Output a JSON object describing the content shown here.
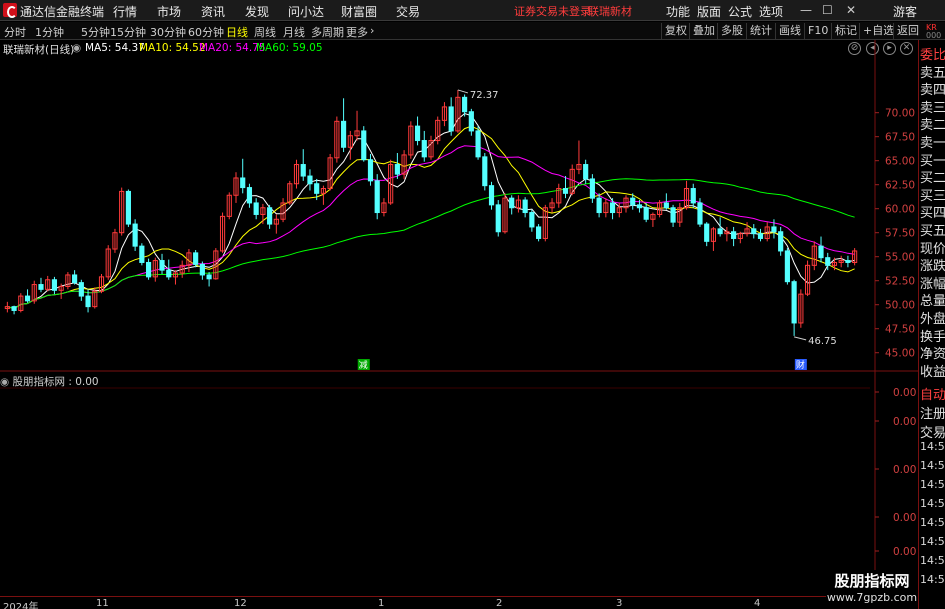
{
  "app": {
    "title": "通达信金融终端"
  },
  "menu": {
    "items": [
      "行情",
      "市场",
      "资讯",
      "发现",
      "问小达",
      "财富圈",
      "交易"
    ],
    "status": "证券交易未登录",
    "stock_link": "联瑞新材",
    "right_items": [
      "功能",
      "版面",
      "公式",
      "选项"
    ],
    "user": "游客"
  },
  "toolbar": {
    "timeframes": [
      "分时",
      "1分钟",
      "5分钟",
      "15分钟",
      "30分钟",
      "60分钟",
      "日线",
      "周线",
      "月线",
      "多周期",
      "更多"
    ],
    "active": "日线",
    "right_buttons": [
      "复权",
      "叠加",
      "多股",
      "统计",
      "画线",
      "F10",
      "标记",
      "+自选",
      "返回"
    ]
  },
  "legend": {
    "stock": "联瑞新材(日线)",
    "ma5_label": "MA5: 54.37",
    "ma10_label": "MA10: 54.52",
    "ma20_label": "MA20: 54.75",
    "ma60_label": "MA60: 59.05",
    "colors": {
      "ma5": "#ffffff",
      "ma10": "#ffff00",
      "ma20": "#ff00ff",
      "ma60": "#00ff00"
    }
  },
  "sub_indicator": {
    "label": "股朋指标网 : 0.00"
  },
  "right_panel": {
    "badge_top": "KR",
    "badge_bottom": "000",
    "labels": [
      "委比",
      "卖五",
      "卖四",
      "卖三",
      "卖二",
      "卖一",
      "买一",
      "买二",
      "买三",
      "买四",
      "买五",
      "现价",
      "涨跌",
      "涨幅",
      "总量",
      "外盘",
      "换手",
      "净资",
      "收益"
    ],
    "sub_labels": [
      "自动",
      "注册",
      "交易"
    ],
    "times": [
      "14:5",
      "14:55",
      "14:56",
      "14:56",
      "14:56",
      "14:56",
      "14:56",
      "14:56"
    ]
  },
  "watermark": {
    "title": "股朋指标网",
    "url": "www.7gpzb.com"
  },
  "bottom_axis": {
    "dates": [
      "2024年",
      "11",
      "12",
      "1",
      "2",
      "3",
      "4"
    ]
  },
  "chart_data": {
    "type": "candlestick",
    "title": "联瑞新材(日线)",
    "y_axis": {
      "ticks": [
        45.0,
        47.5,
        50.0,
        52.5,
        55.0,
        57.5,
        60.0,
        62.5,
        65.0,
        67.5,
        70.0
      ],
      "range": [
        43.2,
        75.8
      ]
    },
    "sub_y_axis": {
      "ticks": [
        "0.00",
        "0.00",
        "0.00",
        "0.00",
        "0.00"
      ]
    },
    "annotations": {
      "high_label": "72.37",
      "low_label": "46.75",
      "markers": [
        "减",
        "财"
      ]
    },
    "candles": [
      [
        49.6,
        50.3,
        49.2,
        49.8
      ],
      [
        49.8,
        49.9,
        49.0,
        49.4
      ],
      [
        49.4,
        51.2,
        49.2,
        50.9
      ],
      [
        50.9,
        51.6,
        50.2,
        50.4
      ],
      [
        50.4,
        52.5,
        50.1,
        52.1
      ],
      [
        52.1,
        52.8,
        51.3,
        51.6
      ],
      [
        51.6,
        53.0,
        51.4,
        52.6
      ],
      [
        52.6,
        52.9,
        51.1,
        51.5
      ],
      [
        51.5,
        52.2,
        50.6,
        51.9
      ],
      [
        51.9,
        53.4,
        51.6,
        53.1
      ],
      [
        53.1,
        53.6,
        52.1,
        52.3
      ],
      [
        52.3,
        52.6,
        50.4,
        50.9
      ],
      [
        50.9,
        51.6,
        49.2,
        49.8
      ],
      [
        49.8,
        51.8,
        49.6,
        51.4
      ],
      [
        51.4,
        53.2,
        51.2,
        52.9
      ],
      [
        52.9,
        56.2,
        52.6,
        55.8
      ],
      [
        55.8,
        57.9,
        55.4,
        57.5
      ],
      [
        57.5,
        62.2,
        57.2,
        61.8
      ],
      [
        61.8,
        62.0,
        58.1,
        58.4
      ],
      [
        58.4,
        58.9,
        55.6,
        56.1
      ],
      [
        56.1,
        56.4,
        54.1,
        54.4
      ],
      [
        54.4,
        54.8,
        52.6,
        52.9
      ],
      [
        52.9,
        54.9,
        52.4,
        54.6
      ],
      [
        54.6,
        55.3,
        53.2,
        53.6
      ],
      [
        53.6,
        54.7,
        52.6,
        52.9
      ],
      [
        52.9,
        53.6,
        52.1,
        53.3
      ],
      [
        53.3,
        54.6,
        52.8,
        54.1
      ],
      [
        54.1,
        55.8,
        53.4,
        55.4
      ],
      [
        55.4,
        55.7,
        53.9,
        54.2
      ],
      [
        54.2,
        54.5,
        52.6,
        53.1
      ],
      [
        53.1,
        53.4,
        51.9,
        52.7
      ],
      [
        52.7,
        55.9,
        52.6,
        55.6
      ],
      [
        55.6,
        59.6,
        55.4,
        59.2
      ],
      [
        59.2,
        61.7,
        58.9,
        61.4
      ],
      [
        61.4,
        63.8,
        60.6,
        63.2
      ],
      [
        63.2,
        65.2,
        61.6,
        62.2
      ],
      [
        62.2,
        62.6,
        60.1,
        60.6
      ],
      [
        60.6,
        61.1,
        58.9,
        59.4
      ],
      [
        59.4,
        60.5,
        58.4,
        60.1
      ],
      [
        60.1,
        60.4,
        57.9,
        58.4
      ],
      [
        58.4,
        59.4,
        57.4,
        58.9
      ],
      [
        58.9,
        61.1,
        58.6,
        60.6
      ],
      [
        60.6,
        62.9,
        60.4,
        62.6
      ],
      [
        62.6,
        65.1,
        62.1,
        64.6
      ],
      [
        64.6,
        66.2,
        62.9,
        63.4
      ],
      [
        63.4,
        64.1,
        61.9,
        62.6
      ],
      [
        62.6,
        63.1,
        60.9,
        61.6
      ],
      [
        61.6,
        62.4,
        60.4,
        62.1
      ],
      [
        62.1,
        65.7,
        61.9,
        65.3
      ],
      [
        65.3,
        69.6,
        64.8,
        69.1
      ],
      [
        69.1,
        71.5,
        65.9,
        66.4
      ],
      [
        66.4,
        68.1,
        65.1,
        67.6
      ],
      [
        67.6,
        70.2,
        67.1,
        68.1
      ],
      [
        68.1,
        68.6,
        64.9,
        65.1
      ],
      [
        65.1,
        65.7,
        62.4,
        62.9
      ],
      [
        62.9,
        63.6,
        58.9,
        59.6
      ],
      [
        59.6,
        61.1,
        59.2,
        60.6
      ],
      [
        60.6,
        65.1,
        60.4,
        64.6
      ],
      [
        64.6,
        65.8,
        63.1,
        63.6
      ],
      [
        63.6,
        66.1,
        63.1,
        65.6
      ],
      [
        65.6,
        69.1,
        65.2,
        68.6
      ],
      [
        68.6,
        69.6,
        66.6,
        67.1
      ],
      [
        67.1,
        68.1,
        64.9,
        65.4
      ],
      [
        65.4,
        67.6,
        65.1,
        67.1
      ],
      [
        67.1,
        69.6,
        66.7,
        69.2
      ],
      [
        69.2,
        71.1,
        68.6,
        70.6
      ],
      [
        70.6,
        71.6,
        67.6,
        68.1
      ],
      [
        68.1,
        72.37,
        67.9,
        71.6
      ],
      [
        71.6,
        71.9,
        69.6,
        70.1
      ],
      [
        70.1,
        70.4,
        67.6,
        68.1
      ],
      [
        68.1,
        68.6,
        65.1,
        65.4
      ],
      [
        65.4,
        65.8,
        61.9,
        62.4
      ],
      [
        62.4,
        62.8,
        59.9,
        60.4
      ],
      [
        60.4,
        60.9,
        57.1,
        57.6
      ],
      [
        57.6,
        61.6,
        57.4,
        61.1
      ],
      [
        61.1,
        61.4,
        59.4,
        60.1
      ],
      [
        60.1,
        61.4,
        59.6,
        60.9
      ],
      [
        60.9,
        61.2,
        59.1,
        59.6
      ],
      [
        59.6,
        59.9,
        57.6,
        58.1
      ],
      [
        58.1,
        58.4,
        56.6,
        56.9
      ],
      [
        56.9,
        60.4,
        56.6,
        60.1
      ],
      [
        60.1,
        61.1,
        59.6,
        60.6
      ],
      [
        60.6,
        62.6,
        60.1,
        62.1
      ],
      [
        62.1,
        63.4,
        61.1,
        61.6
      ],
      [
        61.6,
        64.6,
        61.4,
        64.1
      ],
      [
        64.1,
        67.1,
        63.6,
        64.6
      ],
      [
        64.6,
        65.1,
        62.6,
        63.1
      ],
      [
        63.1,
        63.6,
        60.6,
        61.1
      ],
      [
        61.1,
        61.6,
        59.1,
        59.6
      ],
      [
        59.6,
        61.1,
        59.1,
        60.6
      ],
      [
        60.6,
        61.1,
        58.9,
        59.6
      ],
      [
        59.6,
        60.6,
        59.1,
        60.1
      ],
      [
        60.1,
        61.4,
        59.6,
        61.1
      ],
      [
        61.1,
        61.6,
        59.9,
        60.4
      ],
      [
        60.4,
        60.9,
        59.6,
        60.1
      ],
      [
        60.1,
        60.6,
        58.6,
        58.9
      ],
      [
        58.9,
        59.6,
        58.1,
        59.4
      ],
      [
        59.4,
        60.9,
        59.1,
        60.6
      ],
      [
        60.6,
        61.6,
        59.9,
        60.1
      ],
      [
        60.1,
        60.4,
        58.1,
        58.6
      ],
      [
        58.6,
        60.6,
        58.1,
        60.1
      ],
      [
        60.1,
        62.9,
        59.9,
        62.1
      ],
      [
        62.1,
        62.6,
        60.1,
        60.6
      ],
      [
        60.6,
        61.1,
        58.1,
        58.4
      ],
      [
        58.4,
        58.6,
        56.1,
        56.6
      ],
      [
        56.6,
        58.1,
        55.6,
        57.9
      ],
      [
        57.9,
        59.1,
        57.1,
        57.4
      ],
      [
        57.4,
        58.1,
        56.6,
        57.6
      ],
      [
        57.6,
        58.1,
        56.1,
        56.9
      ],
      [
        56.9,
        57.6,
        56.4,
        57.4
      ],
      [
        57.4,
        58.6,
        57.1,
        57.9
      ],
      [
        57.9,
        58.4,
        56.9,
        57.4
      ],
      [
        57.4,
        57.9,
        56.6,
        56.9
      ],
      [
        56.9,
        58.6,
        56.6,
        58.1
      ],
      [
        58.1,
        58.9,
        56.9,
        57.6
      ],
      [
        57.6,
        58.1,
        55.1,
        55.6
      ],
      [
        55.6,
        55.9,
        52.1,
        52.4
      ],
      [
        52.4,
        52.6,
        46.75,
        48.1
      ],
      [
        48.1,
        51.6,
        47.6,
        51.1
      ],
      [
        51.1,
        54.6,
        50.9,
        54.1
      ],
      [
        54.1,
        56.6,
        53.6,
        56.1
      ],
      [
        56.1,
        57.1,
        54.4,
        54.9
      ],
      [
        54.9,
        55.4,
        53.6,
        54.1
      ],
      [
        54.1,
        54.9,
        53.6,
        54.4
      ],
      [
        54.4,
        55.1,
        53.9,
        54.6
      ],
      [
        54.6,
        55.1,
        53.9,
        54.4
      ],
      [
        54.4,
        55.9,
        54.1,
        55.6
      ]
    ]
  }
}
